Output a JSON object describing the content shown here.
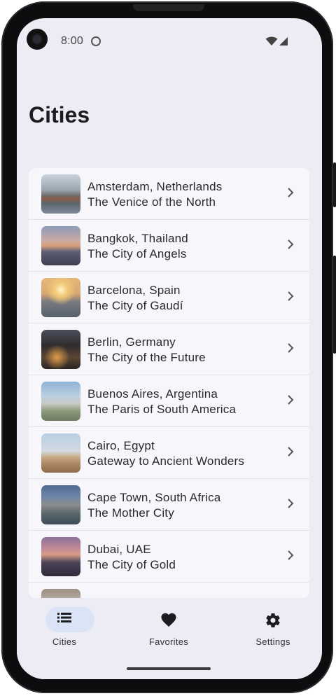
{
  "status_bar": {
    "time": "8:00"
  },
  "page": {
    "title": "Cities"
  },
  "cities": [
    {
      "name": "Amsterdam, Netherlands",
      "subtitle": "The Venice of the North"
    },
    {
      "name": "Bangkok, Thailand",
      "subtitle": "The City of Angels"
    },
    {
      "name": "Barcelona, Spain",
      "subtitle": "The City of Gaudí"
    },
    {
      "name": "Berlin, Germany",
      "subtitle": "The City of the Future"
    },
    {
      "name": "Buenos Aires, Argentina",
      "subtitle": "The Paris of South America"
    },
    {
      "name": "Cairo, Egypt",
      "subtitle": "Gateway to Ancient Wonders"
    },
    {
      "name": "Cape Town, South Africa",
      "subtitle": "The Mother City"
    },
    {
      "name": "Dubai, UAE",
      "subtitle": "The City of Gold"
    }
  ],
  "bottom_nav": {
    "items": [
      {
        "label": "Cities",
        "icon": "list-icon",
        "selected": true
      },
      {
        "label": "Favorites",
        "icon": "heart-icon",
        "selected": false
      },
      {
        "label": "Settings",
        "icon": "gear-icon",
        "selected": false
      }
    ]
  },
  "colors": {
    "background": "#ecedf4",
    "list_background": "#f7f7fb",
    "selected_pill": "#dbe4f7",
    "text": "#1c1b20"
  }
}
